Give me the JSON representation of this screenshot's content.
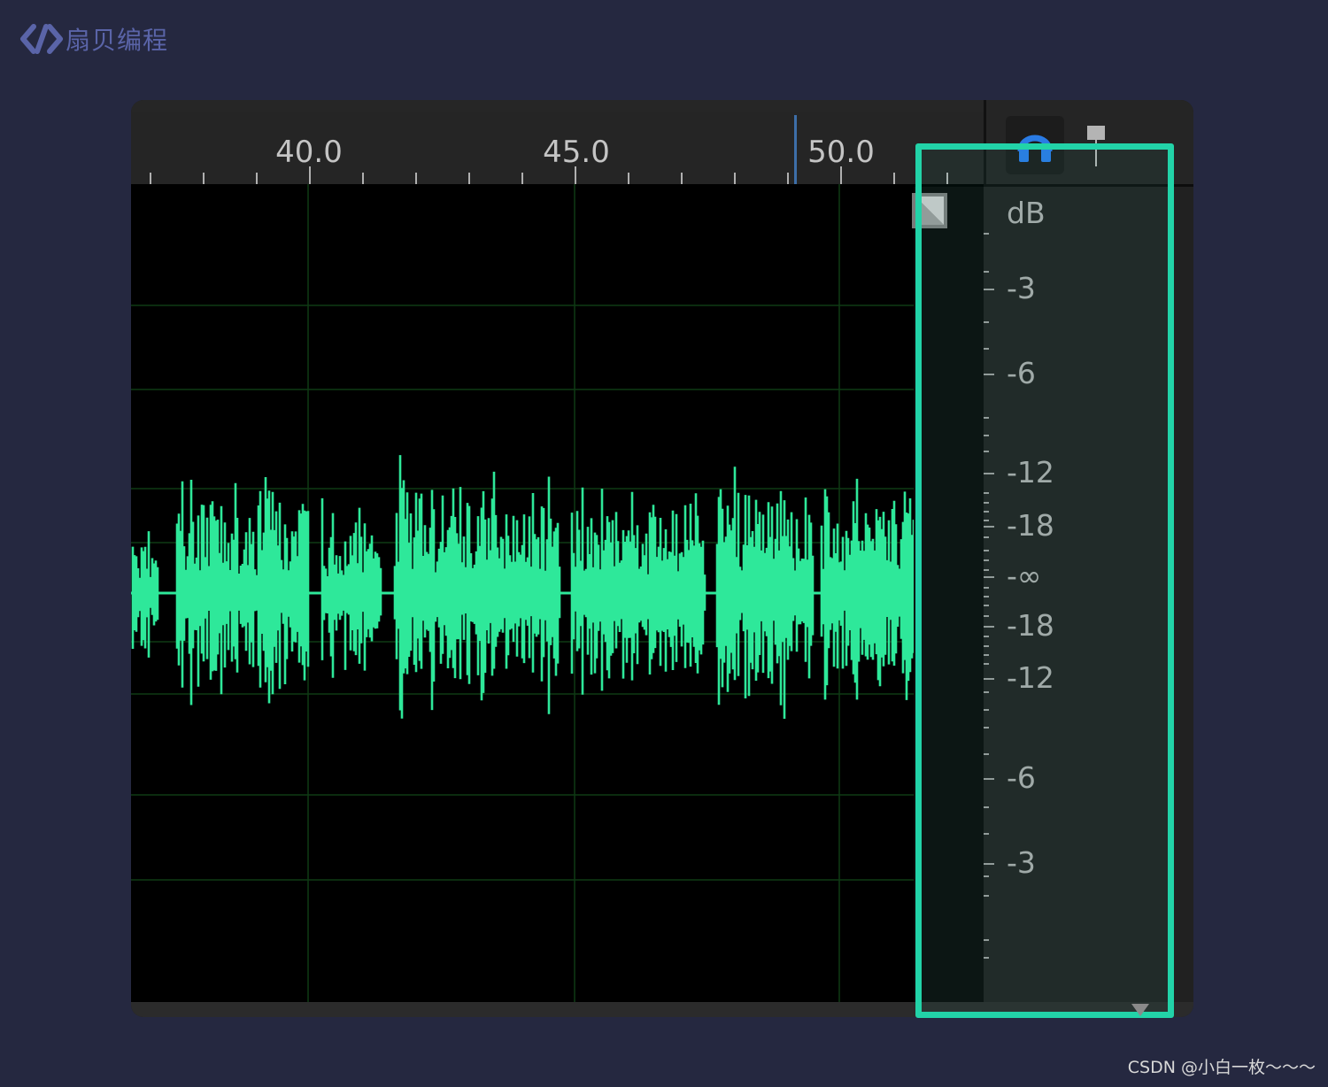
{
  "brand": {
    "logo_text": "扇贝编程"
  },
  "ruler": {
    "labels": [
      "40.0",
      "45.0",
      "50.0"
    ]
  },
  "meter": {
    "unit_label": "dB",
    "scale_labels": [
      "-3",
      "-6",
      "-12",
      "-18",
      "-∞",
      "-18",
      "-12",
      "-6",
      "-3"
    ]
  },
  "colors": {
    "waveform": "#2ee89a",
    "highlight": "#22d3a8",
    "playhead": "#3d6ea8",
    "headphone": "#2a7be4"
  },
  "icons": {
    "monitor": "headphones-icon",
    "marker": "marker-pin-icon",
    "corner": "amplitude-corner-icon"
  },
  "watermark": "CSDN @小白一枚～～～"
}
